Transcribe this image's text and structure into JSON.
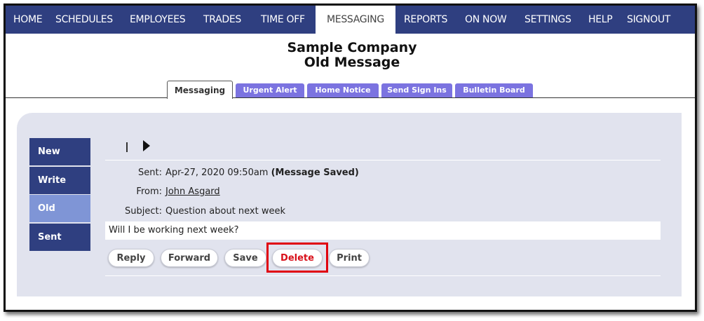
{
  "nav": {
    "items": [
      {
        "label": "HOME"
      },
      {
        "label": "SCHEDULES"
      },
      {
        "label": "EMPLOYEES"
      },
      {
        "label": "TRADES"
      },
      {
        "label": "TIME OFF"
      },
      {
        "label": "MESSAGING",
        "active": true
      },
      {
        "label": "REPORTS"
      },
      {
        "label": "ON NOW"
      },
      {
        "label": "SETTINGS"
      },
      {
        "label": "HELP"
      },
      {
        "label": "SIGNOUT"
      }
    ]
  },
  "header": {
    "company": "Sample Company",
    "title": "Old Message"
  },
  "subtabs": [
    {
      "label": "Messaging",
      "active": true
    },
    {
      "label": "Urgent Alert"
    },
    {
      "label": "Home Notice"
    },
    {
      "label": "Send Sign Ins"
    },
    {
      "label": "Bulletin Board"
    }
  ],
  "sidebar": {
    "items": [
      {
        "label": "New"
      },
      {
        "label": "Write"
      },
      {
        "label": "Old",
        "active": true
      },
      {
        "label": "Sent"
      }
    ]
  },
  "message": {
    "sent_label": "Sent:",
    "sent_value": "Apr-27, 2020 09:50am",
    "sent_status": "(Message Saved)",
    "from_label": "From:",
    "from_value": "John Asgard",
    "subject_label": "Subject:",
    "subject_value": "Question about next week",
    "body": "Will I be working next week?"
  },
  "actions": {
    "reply": "Reply",
    "forward": "Forward",
    "save": "Save",
    "delete": "Delete",
    "print": "Print"
  },
  "colors": {
    "nav_bg": "#2f3f80",
    "subtab_bg": "#7b73e0",
    "panel_bg": "#e1e3ee",
    "sidebar_active": "#7f95d6",
    "highlight": "#e0000f"
  },
  "icons": {
    "pager_next": "triangle-right-icon"
  }
}
